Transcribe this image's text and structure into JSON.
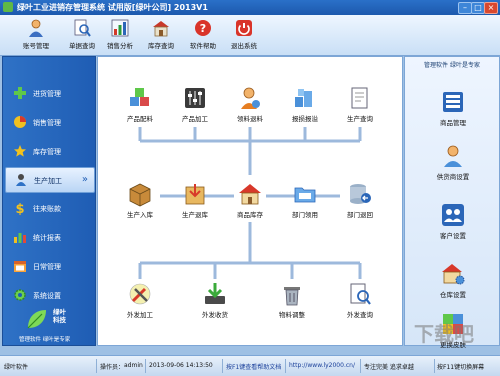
{
  "window": {
    "title": "绿叶工业进销存管理系统 试用版[绿叶公司] 2013V1",
    "minimize_glyph": "–",
    "maximize_glyph": "□",
    "close_glyph": "×"
  },
  "toolbar": {
    "items": [
      {
        "label": "账号管理",
        "icon": "user-account-icon"
      },
      {
        "label": "单据查询",
        "icon": "search-document-icon"
      },
      {
        "label": "销售分析",
        "icon": "chart-icon"
      },
      {
        "label": "库存查询",
        "icon": "warehouse-icon"
      },
      {
        "label": "软件帮助",
        "icon": "help-icon"
      },
      {
        "label": "退出系统",
        "icon": "exit-icon"
      }
    ]
  },
  "sidebar": {
    "items": [
      {
        "label": "进货管理"
      },
      {
        "label": "销售管理"
      },
      {
        "label": "库存管理"
      },
      {
        "label": "生产加工",
        "active": true,
        "chevron": "»"
      },
      {
        "label": "往来账款"
      },
      {
        "label": "统计报表"
      },
      {
        "label": "日常管理"
      },
      {
        "label": "系统设置"
      }
    ],
    "brand": {
      "line1": "绿叶",
      "line2": "科技",
      "slogan": "管理软件 绿叶是专家"
    }
  },
  "main": {
    "row1": [
      "产品配料",
      "产品加工",
      "领料退料",
      "报损报溢",
      "生产查询"
    ],
    "row2": [
      "生产入库",
      "生产退库",
      "商品库存",
      "部门领用",
      "部门退回"
    ],
    "row3": [
      "外发加工",
      "外发收货",
      "物料调整",
      "外发查询"
    ]
  },
  "right_panel": {
    "title": "管理软件 绿叶是专家",
    "items": [
      "商品管理",
      "供货商设置",
      "客户设置",
      "仓库设置",
      "更换皮肤"
    ]
  },
  "statusbar": {
    "software": "绿叶软件",
    "operator_label": "操作员：",
    "operator": "admin",
    "datetime": "2013-09-06 14:13:50",
    "tip": "按F1键查看帮助文档",
    "url": "http://www.ly2000.cn/",
    "motto": "专注完美 追求卓越",
    "shortcut": "按F11键切换屏幕"
  },
  "watermark": "下载吧"
}
